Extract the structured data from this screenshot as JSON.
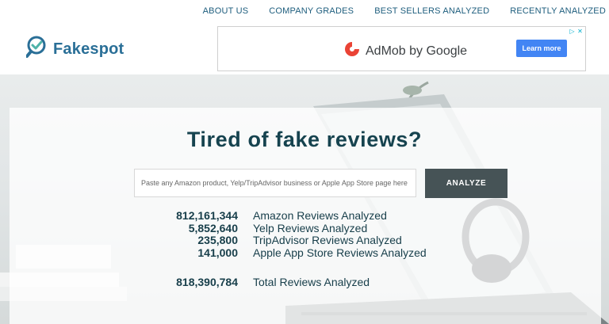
{
  "nav": {
    "items": [
      "ABOUT US",
      "COMPANY GRADES",
      "BEST SELLERS ANALYZED",
      "RECENTLY ANALYZED"
    ]
  },
  "logo": {
    "text": "Fakespot",
    "icon": "magnifier-check-icon"
  },
  "ad": {
    "brand": "AdMob by Google",
    "button_label": "Learn more"
  },
  "hero": {
    "headline": "Tired of fake reviews?",
    "search_placeholder": "Paste any Amazon product, Yelp/TripAdvisor business or Apple App Store page here",
    "analyze_label": "ANALYZE"
  },
  "stats": [
    {
      "value": "812,161,344",
      "label": "Amazon Reviews Analyzed"
    },
    {
      "value": "5,852,640",
      "label": "Yelp Reviews Analyzed"
    },
    {
      "value": "235,800",
      "label": "TripAdvisor Reviews Analyzed"
    },
    {
      "value": "141,000",
      "label": "Apple App Store Reviews Analyzed"
    }
  ],
  "total": {
    "value": "818,390,784",
    "label": "Total Reviews Analyzed"
  },
  "colors": {
    "brand": "#2a6f97",
    "nav_text": "#1d5d7d",
    "headline": "#16434f",
    "button": "#465356"
  }
}
